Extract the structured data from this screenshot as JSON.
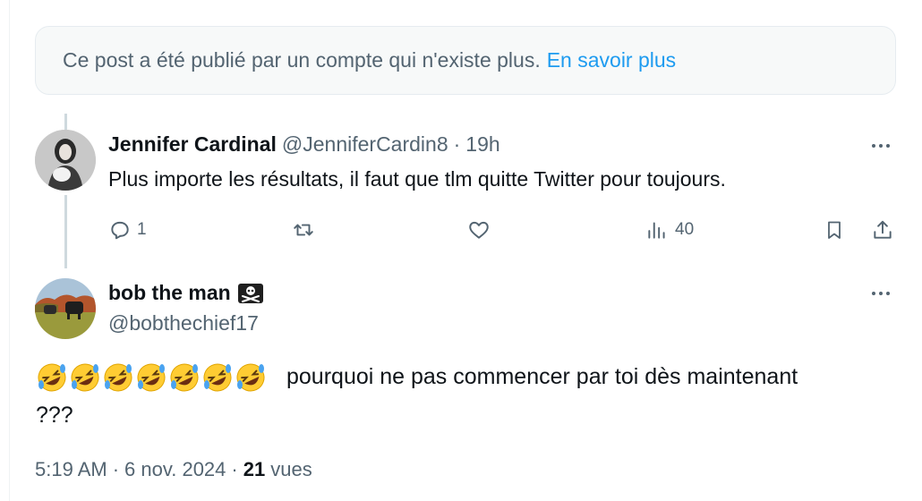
{
  "notice": {
    "text": "Ce post a été publié par un compte qui n'existe plus.",
    "link": "En savoir plus"
  },
  "reply": {
    "author_name": "Jennifer Cardinal",
    "handle": "@JenniferCardin8",
    "separator": "·",
    "time": "19h",
    "text": "Plus importe les résultats, il faut que tlm quitte Twitter pour toujours.",
    "reply_count": "1",
    "views": "40"
  },
  "main": {
    "author_name": "bob the man",
    "handle": "@bobthechief17",
    "name_emoji": "skull-and-crossbones",
    "emoji_count": 7,
    "text": "pourquoi ne pas commencer par toi dès maintenant",
    "text_line2": "???",
    "time": "5:19 AM",
    "dot": "·",
    "date": "6 nov. 2024",
    "dot2": "·",
    "views_count": "21",
    "views_label": "vues"
  },
  "colors": {
    "accent": "#1d9bf0",
    "muted": "#536471",
    "text": "#0f1419"
  }
}
